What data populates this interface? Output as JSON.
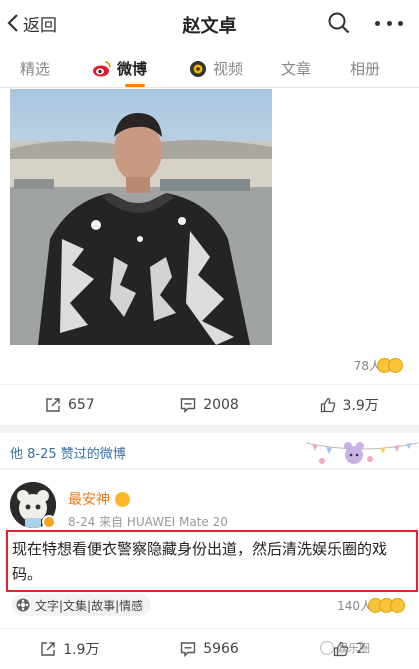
{
  "header": {
    "back_label": "返回",
    "title": "赵文卓"
  },
  "tabs": [
    {
      "label": "精选"
    },
    {
      "label": "微博"
    },
    {
      "label": "视频"
    },
    {
      "label": "文章"
    },
    {
      "label": "相册"
    }
  ],
  "post1": {
    "likes_count": "78人",
    "actions": {
      "repost": "657",
      "comment": "2008",
      "like": "3.9万"
    }
  },
  "liked_section": {
    "header": "他 8-25 赞过的微博"
  },
  "post2": {
    "author": "最安神",
    "meta": "8-24  来自 HUAWEI Mate 20",
    "text": "现在特想看便衣警察隐藏身份出道，然后清洗娱乐圈的戏码。",
    "tag": "文字|文集|故事|情感",
    "likes_count": "140人",
    "actions": {
      "repost": "1.9万",
      "comment": "5966",
      "like": "2"
    }
  },
  "watermark": "娱乐圈"
}
